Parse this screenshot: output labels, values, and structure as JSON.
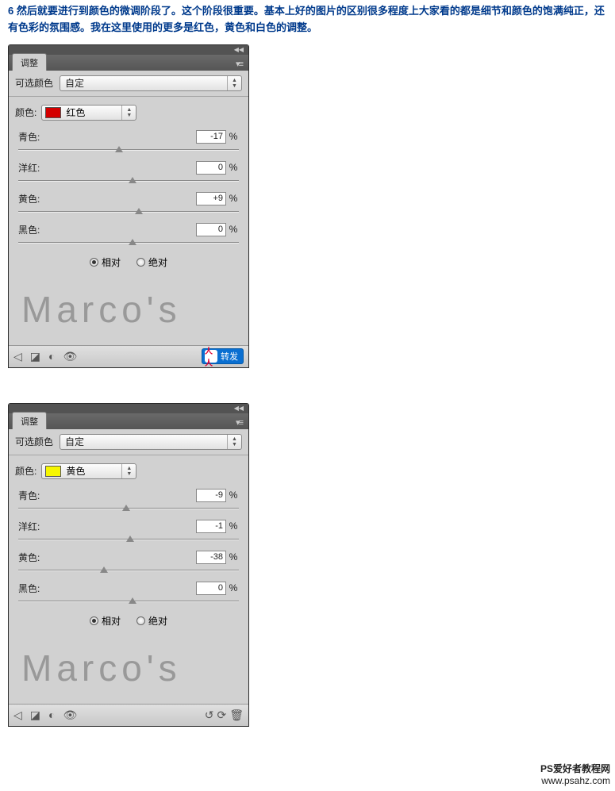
{
  "intro": "6 然后就要进行到颜色的微调阶段了。这个阶段很重要。基本上好的图片的区别很多程度上大家看的都是细节和颜色的饱满纯正，还有色彩的氛围感。我在这里使用的更多是红色，黄色和白色的调整。",
  "panels": [
    {
      "tab_label": "调整",
      "adjustment_label": "可选颜色",
      "preset_value": "自定",
      "color_label": "颜色:",
      "swatch_color": "#d40000",
      "swatch_text": "红色",
      "sliders": {
        "cyan": {
          "label": "青色:",
          "value": "-17",
          "pos": 44
        },
        "magenta": {
          "label": "洋红:",
          "value": "0",
          "pos": 50
        },
        "yellow": {
          "label": "黄色:",
          "value": "+9",
          "pos": 53
        },
        "black": {
          "label": "黑色:",
          "value": "0",
          "pos": 50
        }
      },
      "method": {
        "relative": "相对",
        "absolute": "绝对",
        "selected": "relative"
      },
      "watermark": "Marco's",
      "footer_variant": "share",
      "share_text": "转发"
    },
    {
      "tab_label": "调整",
      "adjustment_label": "可选颜色",
      "preset_value": "自定",
      "color_label": "颜色:",
      "swatch_color": "#f6f600",
      "swatch_text": "黄色",
      "sliders": {
        "cyan": {
          "label": "青色:",
          "value": "-9",
          "pos": 47
        },
        "magenta": {
          "label": "洋红:",
          "value": "-1",
          "pos": 49
        },
        "yellow": {
          "label": "黄色:",
          "value": "-38",
          "pos": 37
        },
        "black": {
          "label": "黑色:",
          "value": "0",
          "pos": 50
        }
      },
      "method": {
        "relative": "相对",
        "absolute": "绝对",
        "selected": "relative"
      },
      "watermark": "Marco's",
      "footer_variant": "std"
    }
  ],
  "percent_sign": "%",
  "site": {
    "line1": "PS爱好者教程网",
    "line2": "www.psahz.com"
  }
}
